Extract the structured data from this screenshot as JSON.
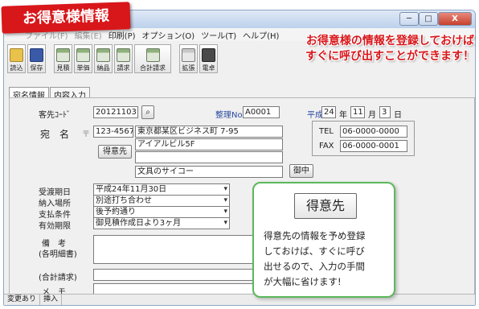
{
  "ribbon": {
    "title": "お得意様情報"
  },
  "window": {
    "controls": {
      "min": "─",
      "max": "□",
      "close": "X"
    },
    "menu": [
      "ファイル(F)",
      "編集(E)",
      "印刷(P)",
      "オプション(O)",
      "ツール(T)",
      "ヘルプ(H)"
    ]
  },
  "toolbar": [
    {
      "label": "読込",
      "icon": "open-folder-icon"
    },
    {
      "label": "保存",
      "icon": "floppy-disk-icon"
    },
    {
      "label": "見積",
      "icon": "printer-icon"
    },
    {
      "label": "単価",
      "icon": "printer-icon"
    },
    {
      "label": "納品",
      "icon": "printer-icon"
    },
    {
      "label": "請求",
      "icon": "printer-icon"
    },
    {
      "label": "合計請求",
      "icon": "printer-icon"
    },
    {
      "label": "拡張",
      "icon": "extension-icon"
    },
    {
      "label": "電卓",
      "icon": "calculator-icon"
    }
  ],
  "promo_top": {
    "line1": "お得意様の情報を登録しておけば",
    "line2": "すぐに呼び出すことができます！"
  },
  "tabs": [
    "宛名情報",
    "内容入力"
  ],
  "form": {
    "code_label": "客先ｺｰﾄﾞ",
    "code_value": "20121103",
    "seiri_label": "整理No",
    "seiri_value": "A0001",
    "era_label": "平成",
    "year": "24",
    "year_label": "年",
    "month": "11",
    "month_label": "月",
    "day": "3",
    "day_label": "日",
    "name_label": "宛　名",
    "postal_mark": "〒",
    "postal_code": "123-4567",
    "address1": "東京都某区ビジネス町 7-95",
    "address2": "アイアルビル5F",
    "address3": "",
    "company": "文具のサイコー",
    "customer_button": "得意先",
    "honorific_button": "御中",
    "tel_label": "TEL",
    "tel_value": "06-0000-0000",
    "fax_label": "FAX",
    "fax_value": "06-0000-0001",
    "delivery_label": "受渡期日",
    "delivery_value": "平成24年11月30日",
    "place_label": "納入場所",
    "place_value": "別途打ち合わせ",
    "payment_label": "支払条件",
    "payment_value": "後予約通り",
    "validity_label": "有効期限",
    "validity_value": "御見積作成日より3ヶ月",
    "note_label": "備　考",
    "note_sub": "(各明細書)",
    "total_label": "(合計請求)",
    "memo_label": "メ　モ"
  },
  "status": [
    "変更あり",
    "挿入"
  ],
  "callout": {
    "button": "得意先",
    "lines": [
      "得意先の情報を予め登録",
      "しておけば、すぐに呼び",
      "出せるので、入力の手間",
      "が大幅に省けます!"
    ]
  }
}
